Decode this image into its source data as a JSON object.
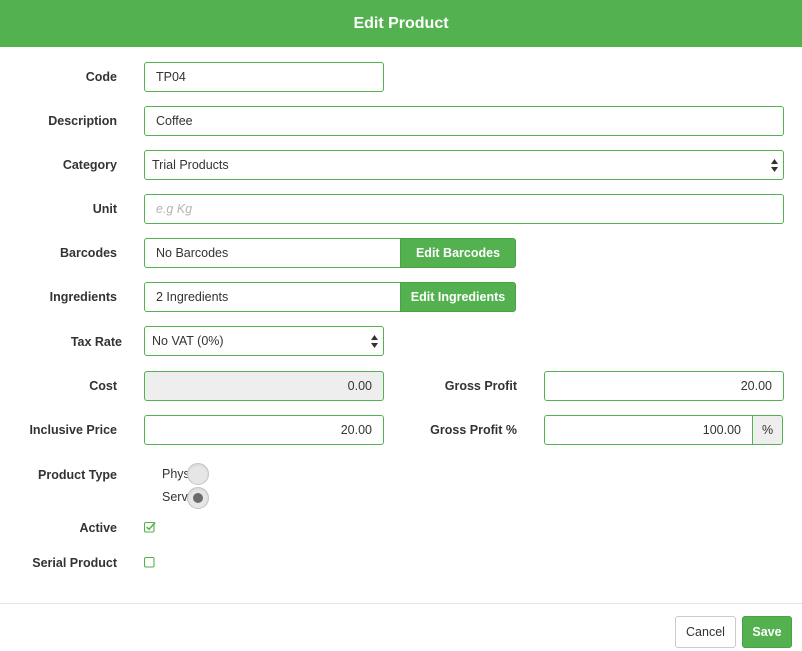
{
  "dialog": {
    "title": "Edit Product"
  },
  "form": {
    "code": {
      "label": "Code",
      "value": "TP04"
    },
    "description": {
      "label": "Description",
      "value": "Coffee"
    },
    "category": {
      "label": "Category",
      "value": "Trial Products"
    },
    "unit": {
      "label": "Unit",
      "value": "",
      "placeholder": "e.g Kg"
    },
    "barcodes": {
      "label": "Barcodes",
      "value": "No Barcodes",
      "button": "Edit Barcodes"
    },
    "ingredients": {
      "label": "Ingredients",
      "value": "2 Ingredients",
      "button": "Edit Ingredients"
    },
    "tax_rate": {
      "label": "Tax Rate",
      "value": "No VAT (0%)"
    },
    "cost": {
      "label": "Cost",
      "value": "0.00"
    },
    "inclusive_price": {
      "label": "Inclusive Price",
      "value": "20.00"
    },
    "gross_profit": {
      "label": "Gross Profit",
      "value": "20.00"
    },
    "gross_profit_pct": {
      "label": "Gross Profit %",
      "value": "100.00",
      "addon": "%"
    },
    "product_type": {
      "label": "Product Type",
      "options": [
        {
          "label": "Phys",
          "selected": false
        },
        {
          "label": "Servi",
          "selected": true
        }
      ]
    },
    "active": {
      "label": "Active",
      "checked": true
    },
    "serial_product": {
      "label": "Serial Product",
      "checked": false
    }
  },
  "footer": {
    "cancel": "Cancel",
    "save": "Save"
  },
  "colors": {
    "accent": "#53b14f",
    "disabled_bg": "#eeeeee",
    "text": "#333333"
  },
  "icons": [
    "select-arrows-icon",
    "checkbox-checked-icon",
    "checkbox-empty-icon"
  ]
}
